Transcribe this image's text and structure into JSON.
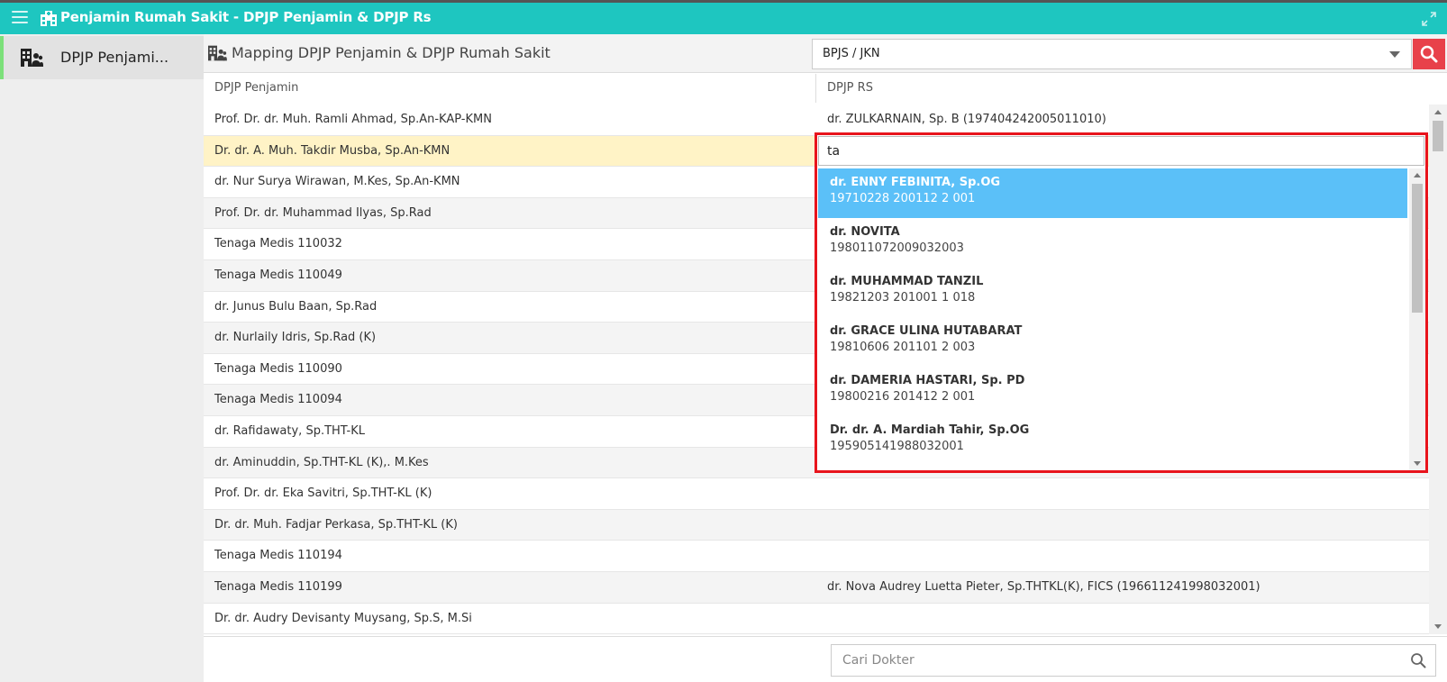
{
  "app": {
    "title": "Penjamin Rumah Sakit - DPJP Penjamin & DPJP Rs"
  },
  "sidebar": {
    "item_label": "DPJP Penjami..."
  },
  "main": {
    "heading": "Mapping DPJP Penjamin & DPJP Rumah Sakit",
    "penjamin_selected": "BPJS / JKN",
    "columns": {
      "left": "DPJP Penjamin",
      "right": "DPJP RS"
    }
  },
  "rows": [
    {
      "penjamin": "Prof. Dr. dr. Muh. Ramli Ahmad, Sp.An-KAP-KMN",
      "rs": "dr. ZULKARNAIN, Sp. B (197404242005011010)"
    },
    {
      "penjamin": "Dr. dr. A. Muh. Takdir Musba, Sp.An-KMN",
      "rs": ""
    },
    {
      "penjamin": "dr. Nur Surya Wirawan, M.Kes, Sp.An-KMN",
      "rs": ""
    },
    {
      "penjamin": "Prof. Dr. dr. Muhammad Ilyas, Sp.Rad",
      "rs": ""
    },
    {
      "penjamin": "Tenaga Medis 110032",
      "rs": ""
    },
    {
      "penjamin": "Tenaga Medis 110049",
      "rs": ""
    },
    {
      "penjamin": "dr. Junus Bulu Baan, Sp.Rad",
      "rs": ""
    },
    {
      "penjamin": "dr. Nurlaily Idris, Sp.Rad (K)",
      "rs": ""
    },
    {
      "penjamin": "Tenaga Medis 110090",
      "rs": ""
    },
    {
      "penjamin": "Tenaga Medis 110094",
      "rs": ""
    },
    {
      "penjamin": "dr. Rafidawaty, Sp.THT-KL",
      "rs": ""
    },
    {
      "penjamin": "dr. Aminuddin, Sp.THT-KL (K),. M.Kes",
      "rs": ""
    },
    {
      "penjamin": "Prof. Dr. dr. Eka Savitri, Sp.THT-KL (K)",
      "rs": ""
    },
    {
      "penjamin": "Dr. dr. Muh. Fadjar Perkasa, Sp.THT-KL (K)",
      "rs": ""
    },
    {
      "penjamin": "Tenaga Medis 110194",
      "rs": ""
    },
    {
      "penjamin": "Tenaga Medis 110199",
      "rs": "dr. Nova Audrey Luetta Pieter, Sp.THTKL(K), FICS (196611241998032001)"
    },
    {
      "penjamin": "Dr. dr. Audry Devisanty Muysang, Sp.S, M.Si",
      "rs": ""
    }
  ],
  "dropdown": {
    "query": "ta",
    "options": [
      {
        "name": "dr. ENNY FEBINITA, Sp.OG",
        "id": "19710228 200112 2 001"
      },
      {
        "name": "dr. NOVITA",
        "id": "198011072009032003"
      },
      {
        "name": "dr. MUHAMMAD TANZIL",
        "id": "19821203 201001 1 018"
      },
      {
        "name": "dr. GRACE ULINA HUTABARAT",
        "id": "19810606 201101 2 003"
      },
      {
        "name": "dr. DAMERIA HASTARI, Sp. PD",
        "id": "19800216 201412 2 001"
      },
      {
        "name": "Dr. dr. A. Mardiah Tahir, Sp.OG",
        "id": "195905141988032001"
      }
    ]
  },
  "footer": {
    "search_placeholder": "Cari Dokter"
  },
  "colors": {
    "topbar": "#1ec6c0",
    "accent_red": "#e8414a",
    "highlight": "#5bc0f8",
    "selected_row": "#fff3c6",
    "sidebar_active": "#7ce07a"
  },
  "icons": {
    "menu": "hamburger-icon",
    "hospital": "hospital-icon",
    "expand": "expand-icon",
    "users": "building-users-icon",
    "search": "search-icon"
  }
}
